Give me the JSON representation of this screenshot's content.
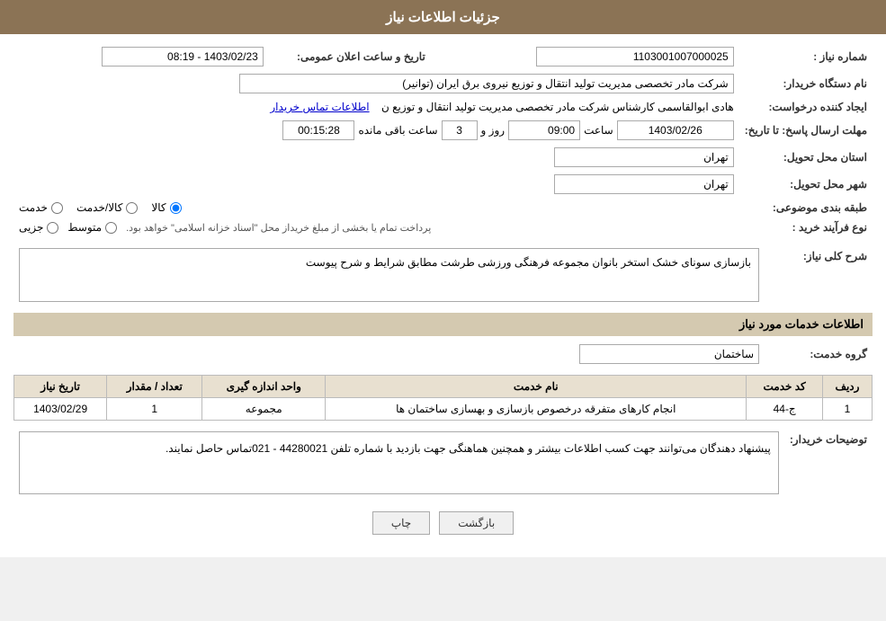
{
  "header": {
    "title": "جزئیات اطلاعات نیاز"
  },
  "fields": {
    "need_number_label": "شماره نیاز :",
    "need_number_value": "1103001007000025",
    "buyer_org_label": "نام دستگاه خریدار:",
    "buyer_org_value": "شرکت مادر تخصصی مدیریت تولید  انتقال و توزیع نیروی برق ایران (توانیر)",
    "creator_label": "ایجاد کننده درخواست:",
    "creator_value": "هادی ابوالقاسمی کارشناس شرکت مادر تخصصی مدیریت تولید  انتقال و توزیع ن",
    "creator_link": "اطلاعات تماس خریدار",
    "send_date_label": "مهلت ارسال پاسخ: تا تاریخ:",
    "send_date_value": "1403/02/26",
    "send_time_label": "ساعت",
    "send_time_value": "09:00",
    "send_days_label": "روز و",
    "send_days_value": "3",
    "remaining_label": "ساعت باقی مانده",
    "remaining_value": "00:15:28",
    "announce_date_label": "تاریخ و ساعت اعلان عمومی:",
    "announce_date_value": "1403/02/23 - 08:19",
    "province_label": "استان محل تحویل:",
    "province_value": "تهران",
    "city_label": "شهر محل تحویل:",
    "city_value": "تهران",
    "category_label": "طبقه بندی موضوعی:",
    "category_options": [
      "خدمت",
      "کالا/خدمت",
      "کالا"
    ],
    "category_selected": "کالا",
    "process_label": "نوع فرآیند خرید :",
    "process_options": [
      "جزیی",
      "متوسط"
    ],
    "process_note": "پرداخت تمام یا بخشی از مبلغ خریداز محل \"اسناد خزانه اسلامی\" خواهد بود.",
    "description_label": "شرح کلی نیاز:",
    "description_value": "بازسازی سونای خشک استخر بانوان مجموعه فرهنگی ورزشی طرشت مطابق شرایط و شرح پیوست",
    "services_section_label": "اطلاعات خدمات مورد نیاز",
    "service_group_label": "گروه خدمت:",
    "service_group_value": "ساختمان",
    "services_table": {
      "headers": [
        "ردیف",
        "کد خدمت",
        "نام خدمت",
        "واحد اندازه گیری",
        "تعداد / مقدار",
        "تاریخ نیاز"
      ],
      "rows": [
        {
          "row": "1",
          "code": "ج-44",
          "name": "انجام کارهای متفرقه درخصوص بازسازی و بهسازی ساختمان ها",
          "unit": "مجموعه",
          "count": "1",
          "date": "1403/02/29"
        }
      ]
    },
    "buyer_notes_label": "توضیحات خریدار:",
    "buyer_notes_value": "پیشنهاد دهندگان می‌توانند جهت کسب اطلاعات بیشتر و همچنین هماهنگی جهت بازدید با شماره تلفن  44280021 - 021تماس حاصل نمایند."
  },
  "buttons": {
    "back_label": "بازگشت",
    "print_label": "چاپ"
  }
}
